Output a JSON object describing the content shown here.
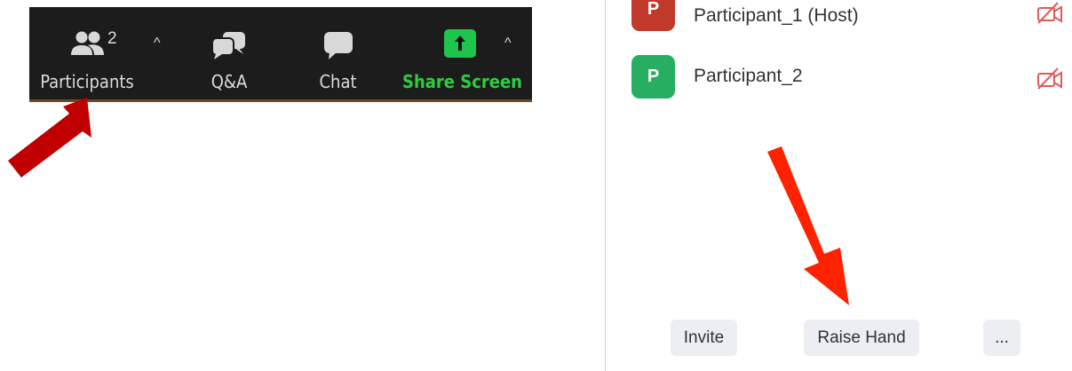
{
  "toolbar": {
    "participants_label": "Participants",
    "participants_count": "2",
    "qa_label": "Q&A",
    "chat_label": "Chat",
    "share_label": "Share Screen",
    "caret": "^"
  },
  "participants": [
    {
      "initial": "P",
      "name": "Participant_1 (Host)",
      "avatar_color": "#c0392b"
    },
    {
      "initial": "P",
      "name": "Participant_2",
      "avatar_color": "#27ae60"
    }
  ],
  "buttons": {
    "invite": "Invite",
    "raise_hand": "Raise Hand",
    "more": "..."
  },
  "colors": {
    "toolbar_bg": "#1c1c1c",
    "share_green": "#1fc44d",
    "arrow_dark_red": "#c00000",
    "arrow_red": "#ff2200",
    "mute_red": "#e05a5a"
  }
}
